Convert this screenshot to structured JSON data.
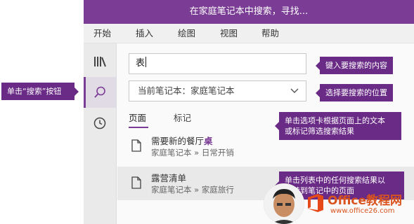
{
  "window": {
    "title": "在家庭笔记本中搜索，寻找..."
  },
  "menu": [
    "开始",
    "插入",
    "绘图",
    "视图",
    "帮助"
  ],
  "nav": {
    "notebooks_icon": "notebooks-icon",
    "search_icon": "search-icon",
    "recent_icon": "clock-icon"
  },
  "search": {
    "value": "表"
  },
  "scope": {
    "label": "当前笔记本：家庭笔记本",
    "icon": "chevron-down-icon"
  },
  "tabs": [
    {
      "label": "页面",
      "active": true
    },
    {
      "label": "标记",
      "active": false
    }
  ],
  "results": [
    {
      "title_before": "需要新的餐厅",
      "title_highlight": "桌",
      "path": "家庭笔记本 » 日常开销",
      "selected": false
    },
    {
      "title_before": "露营清单",
      "title_highlight": "",
      "path": "家庭笔记本 » 家庭旅行",
      "selected": true
    }
  ],
  "callouts": {
    "search_button": "单击“搜索”按钮",
    "type_content": "键入要搜索的内容",
    "choose_scope": "选择要搜索的位置",
    "tabs": [
      "单击选项卡根据页面上的文本",
      "或标记筛选搜索结果"
    ],
    "results": [
      "单击列表中的任何搜索结果以",
      "跳转到笔记中的页面"
    ]
  },
  "watermark": {
    "brand": "Office教程网",
    "url": "www.office26.com",
    "behind_text": "结果"
  },
  "colors": {
    "accent": "#7a3c94",
    "callout": "#6a2b86",
    "highlight": "#7a3c94",
    "watermark": "#d9531e"
  }
}
